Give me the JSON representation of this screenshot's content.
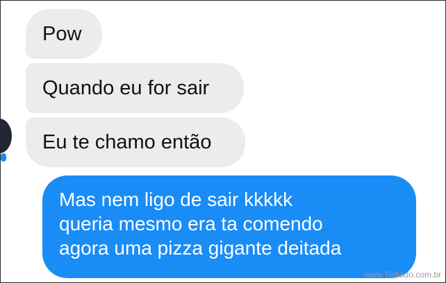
{
  "messages": {
    "incoming": [
      "Pow",
      "Quando eu for sair",
      "Eu te chamo então"
    ],
    "outgoing": {
      "lines": [
        "Mas nem ligo de sair kkkkk",
        "queria mesmo era ta comendo",
        "agora uma pizza gigante deitada"
      ]
    }
  },
  "watermark": "www.Tediado.com.br",
  "icons": {
    "avatar": "contact-avatar"
  },
  "colors": {
    "incoming_bubble": "#ececec",
    "outgoing_bubble": "#1a8cf6",
    "outgoing_text": "#ffffff"
  }
}
